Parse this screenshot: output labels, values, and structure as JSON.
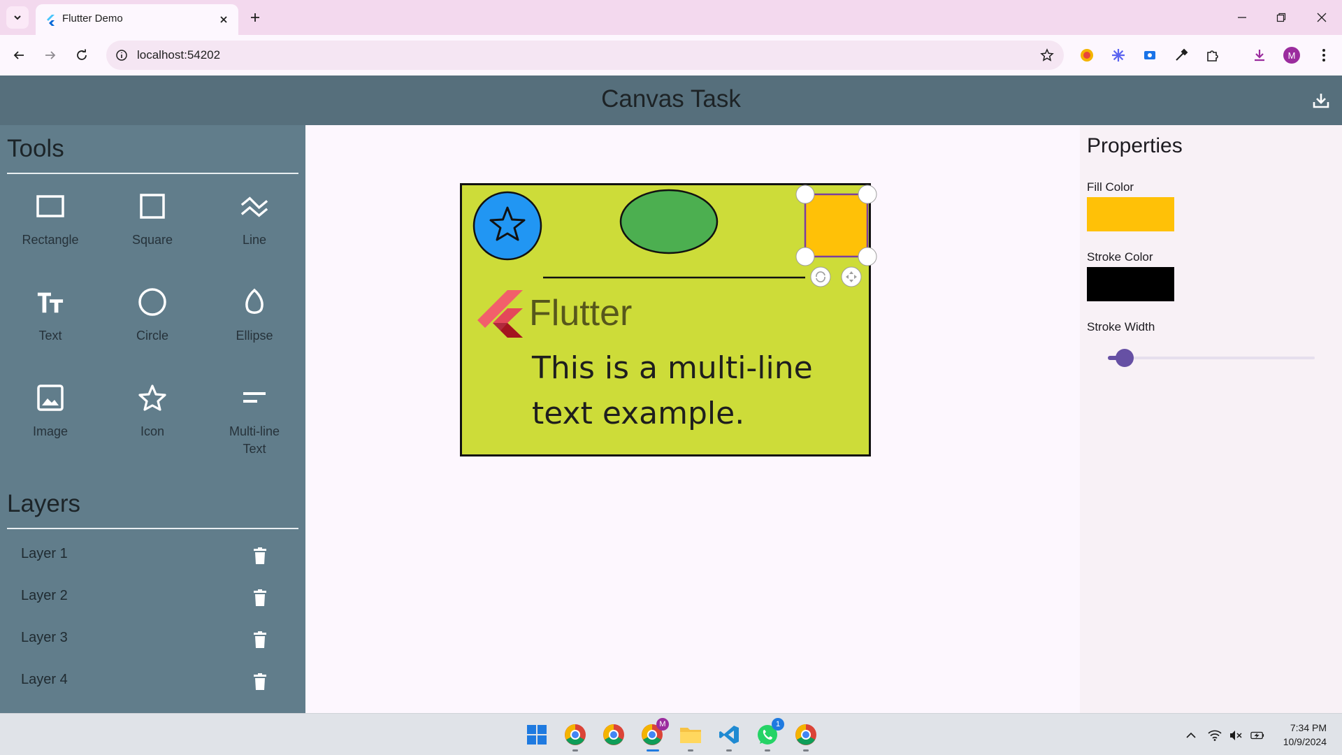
{
  "browser": {
    "tab_title": "Flutter Demo",
    "url": "localhost:54202",
    "profile_initial": "M"
  },
  "app": {
    "title": "Canvas Task"
  },
  "tools_panel": {
    "heading": "Tools",
    "tools": [
      {
        "label": "Rectangle",
        "icon": "rectangle-icon"
      },
      {
        "label": "Square",
        "icon": "square-icon"
      },
      {
        "label": "Line",
        "icon": "line-icon"
      },
      {
        "label": "Text",
        "icon": "text-icon"
      },
      {
        "label": "Circle",
        "icon": "circle-icon"
      },
      {
        "label": "Ellipse",
        "icon": "ellipse-icon"
      },
      {
        "label": "Image",
        "icon": "image-icon"
      },
      {
        "label": "Icon",
        "icon": "star-icon"
      },
      {
        "label": "Multi-line Text",
        "icon": "multiline-text-icon"
      }
    ]
  },
  "layers_panel": {
    "heading": "Layers",
    "layers": [
      {
        "label": "Layer 1"
      },
      {
        "label": "Layer 2"
      },
      {
        "label": "Layer 3"
      },
      {
        "label": "Layer 4"
      }
    ]
  },
  "canvas": {
    "background_color": "#cddc39",
    "circle_color": "#2196f3",
    "ellipse_color": "#4caf50",
    "selected_square_color": "#ffc107",
    "flutter_label": "Flutter",
    "multiline_text_1": "This is a multi-line",
    "multiline_text_2": "text example."
  },
  "properties_panel": {
    "heading": "Properties",
    "fill_color_label": "Fill Color",
    "fill_color": "#ffc107",
    "stroke_color_label": "Stroke Color",
    "stroke_color": "#000000",
    "stroke_width_label": "Stroke Width",
    "stroke_width_fraction": 0.08
  },
  "taskbar": {
    "time": "7:34 PM",
    "date": "10/9/2024",
    "whatsapp_badge": "1",
    "chrome_profile_badge": "M"
  }
}
